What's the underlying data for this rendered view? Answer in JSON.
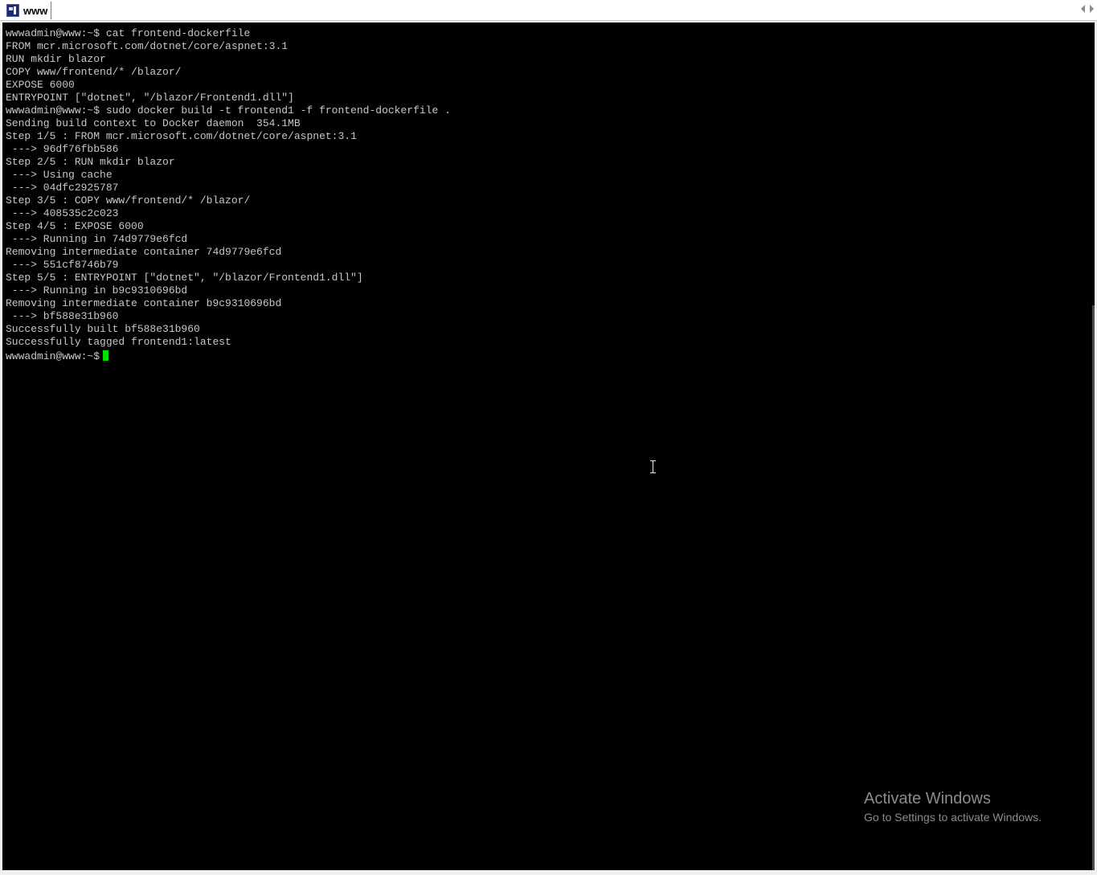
{
  "tab": {
    "title": "www",
    "icon": "putty-terminal-icon"
  },
  "terminal": {
    "lines": [
      "wwwadmin@www:~$ cat frontend-dockerfile",
      "FROM mcr.microsoft.com/dotnet/core/aspnet:3.1",
      "RUN mkdir blazor",
      "COPY www/frontend/* /blazor/",
      "EXPOSE 6000",
      "ENTRYPOINT [\"dotnet\", \"/blazor/Frontend1.dll\"]",
      "wwwadmin@www:~$ sudo docker build -t frontend1 -f frontend-dockerfile .",
      "Sending build context to Docker daemon  354.1MB",
      "Step 1/5 : FROM mcr.microsoft.com/dotnet/core/aspnet:3.1",
      " ---> 96df76fbb586",
      "Step 2/5 : RUN mkdir blazor",
      " ---> Using cache",
      " ---> 04dfc2925787",
      "Step 3/5 : COPY www/frontend/* /blazor/",
      " ---> 408535c2c023",
      "Step 4/5 : EXPOSE 6000",
      " ---> Running in 74d9779e6fcd",
      "Removing intermediate container 74d9779e6fcd",
      " ---> 551cf8746b79",
      "Step 5/5 : ENTRYPOINT [\"dotnet\", \"/blazor/Frontend1.dll\"]",
      " ---> Running in b9c9310696bd",
      "Removing intermediate container b9c9310696bd",
      " ---> bf588e31b960",
      "Successfully built bf588e31b960",
      "Successfully tagged frontend1:latest"
    ],
    "prompt": "wwwadmin@www:~$",
    "cursor_color": "#00e000",
    "background_color": "#000000",
    "text_color": "#c8c8c8"
  },
  "watermark": {
    "title": "Activate Windows",
    "subtitle": "Go to Settings to activate Windows."
  }
}
